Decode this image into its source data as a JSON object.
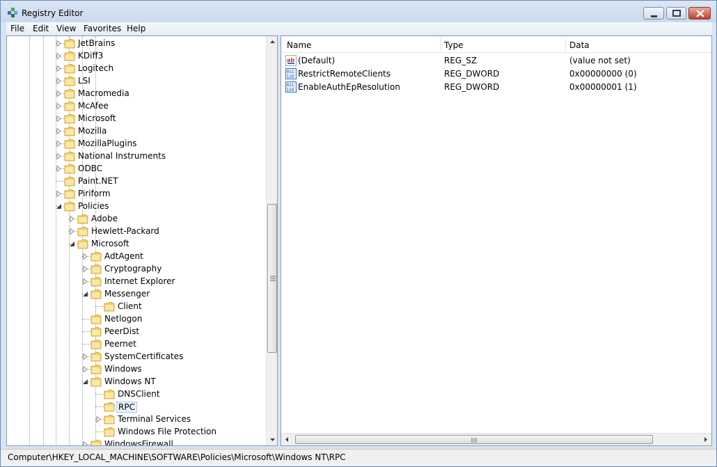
{
  "window": {
    "title": "Registry Editor"
  },
  "menu": [
    "File",
    "Edit",
    "View",
    "Favorites",
    "Help"
  ],
  "tree": [
    {
      "label": "JetBrains",
      "expander": "collapsed"
    },
    {
      "label": "KDiff3",
      "expander": "collapsed"
    },
    {
      "label": "Logitech",
      "expander": "collapsed"
    },
    {
      "label": "LSI",
      "expander": "collapsed"
    },
    {
      "label": "Macromedia",
      "expander": "collapsed"
    },
    {
      "label": "McAfee",
      "expander": "collapsed"
    },
    {
      "label": "Microsoft",
      "expander": "collapsed"
    },
    {
      "label": "Mozilla",
      "expander": "collapsed"
    },
    {
      "label": "MozillaPlugins",
      "expander": "collapsed"
    },
    {
      "label": "National Instruments",
      "expander": "collapsed"
    },
    {
      "label": "ODBC",
      "expander": "collapsed"
    },
    {
      "label": "Paint.NET",
      "expander": "none"
    },
    {
      "label": "Piriform",
      "expander": "collapsed"
    },
    {
      "label": "Policies",
      "expander": "expanded"
    },
    {
      "label": "Adobe",
      "expander": "collapsed"
    },
    {
      "label": "Hewlett-Packard",
      "expander": "collapsed"
    },
    {
      "label": "Microsoft",
      "expander": "expanded"
    },
    {
      "label": "AdtAgent",
      "expander": "collapsed"
    },
    {
      "label": "Cryptography",
      "expander": "collapsed"
    },
    {
      "label": "Internet Explorer",
      "expander": "collapsed"
    },
    {
      "label": "Messenger",
      "expander": "expanded"
    },
    {
      "label": "Client",
      "expander": "none"
    },
    {
      "label": "Netlogon",
      "expander": "none"
    },
    {
      "label": "PeerDist",
      "expander": "none"
    },
    {
      "label": "Peernet",
      "expander": "none"
    },
    {
      "label": "SystemCertificates",
      "expander": "collapsed"
    },
    {
      "label": "Windows",
      "expander": "collapsed"
    },
    {
      "label": "Windows NT",
      "expander": "expanded"
    },
    {
      "label": "DNSClient",
      "expander": "none"
    },
    {
      "label": "RPC",
      "expander": "none",
      "selected": true
    },
    {
      "label": "Terminal Services",
      "expander": "collapsed"
    },
    {
      "label": "Windows File Protection",
      "expander": "none"
    },
    {
      "label": "WindowsFirewall",
      "expander": "collapsed"
    }
  ],
  "list": {
    "columns": [
      "Name",
      "Type",
      "Data"
    ],
    "rows": [
      {
        "icon": "string-value-icon",
        "name": "(Default)",
        "type": "REG_SZ",
        "data": "(value not set)"
      },
      {
        "icon": "binary-value-icon",
        "name": "RestrictRemoteClients",
        "type": "REG_DWORD",
        "data": "0x00000000 (0)"
      },
      {
        "icon": "binary-value-icon",
        "name": "EnableAuthEpResolution",
        "type": "REG_DWORD",
        "data": "0x00000001 (1)"
      }
    ]
  },
  "status": {
    "path": "Computer\\HKEY_LOCAL_MACHINE\\SOFTWARE\\Policies\\Microsoft\\Windows NT\\RPC"
  },
  "colors": {
    "folder": "#f4cf5f",
    "selection_border": "#7aa2d0",
    "close_button": "#c3402b"
  }
}
